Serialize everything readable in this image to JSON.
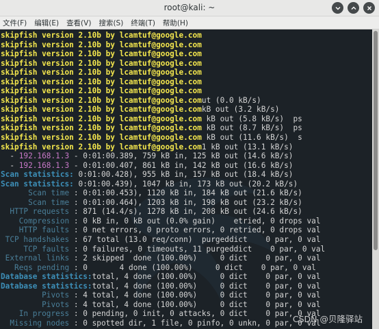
{
  "window": {
    "title": "root@kali: ~",
    "buttons": [
      {
        "name": "minimize",
        "icon": "minimize-icon"
      },
      {
        "name": "maximize",
        "icon": "maximize-icon"
      },
      {
        "name": "close",
        "icon": "close-icon"
      }
    ]
  },
  "menu": [
    {
      "id": "file",
      "label": "文件(F)"
    },
    {
      "id": "edit",
      "label": "编辑(E)"
    },
    {
      "id": "view",
      "label": "查看(V)"
    },
    {
      "id": "search",
      "label": "搜索(S)"
    },
    {
      "id": "terminal",
      "label": "终端(T)"
    },
    {
      "id": "help",
      "label": "帮助(H)"
    }
  ],
  "terminal": {
    "lines": [
      [
        {
          "t": "skipfish version 2.10b by lcamtuf@google.com",
          "c": "yellow"
        }
      ],
      [
        {
          "t": "skipfish version 2.10b by lcamtuf@google.com",
          "c": "yellow"
        }
      ],
      [
        {
          "t": "skipfish version 2.10b by lcamtuf@google.com",
          "c": "yellow"
        }
      ],
      [
        {
          "t": "skipfish version 2.10b by lcamtuf@google.com",
          "c": "yellow"
        }
      ],
      [
        {
          "t": "skipfish version 2.10b by lcamtuf@google.com",
          "c": "yellow"
        }
      ],
      [
        {
          "t": "skipfish version 2.10b by lcamtuf@google.com",
          "c": "yellow"
        }
      ],
      [
        {
          "t": "skipfish version 2.10b by lcamtuf@google.com",
          "c": "yellow"
        }
      ],
      [
        {
          "t": "skipfish version 2.10b by lcamtuf@google.com",
          "c": "yellow"
        },
        {
          "t": "ut (0.0 kB/s)",
          "c": ""
        }
      ],
      [
        {
          "t": "skipfish version 2.10b by lcamtuf@google.com",
          "c": "yellow"
        },
        {
          "t": "kB out (3.2 kB/s)",
          "c": ""
        }
      ],
      [
        {
          "t": "skipfish version 2.10b by lcamtuf@google.com",
          "c": "yellow"
        },
        {
          "t": " kB out (5.8 kB/s)  ps",
          "c": ""
        }
      ],
      [
        {
          "t": "skipfish version 2.10b by lcamtuf@google.com",
          "c": "yellow"
        },
        {
          "t": " kB out (8.7 kB/s)  ps",
          "c": ""
        }
      ],
      [
        {
          "t": "skipfish version 2.10b by lcamtuf@google.com",
          "c": "yellow"
        },
        {
          "t": " kB out (11.6 kB/s)  s",
          "c": ""
        }
      ],
      [
        {
          "t": "skipfish version 2.10b by lcamtuf@google.com",
          "c": "yellow"
        },
        {
          "t": "1 kB out (13.1 kB/s)",
          "c": ""
        }
      ],
      [
        {
          "t": "  - ",
          "c": "dash"
        },
        {
          "t": "192.168.1.3",
          "c": "ip"
        },
        {
          "t": " - 0:01:00.389, 759 kB in, 125 kB out (14.6 kB/s)",
          "c": ""
        }
      ],
      [
        {
          "t": "  - ",
          "c": "dash"
        },
        {
          "t": "192.168.1.3",
          "c": "ip"
        },
        {
          "t": " - 0:01:00.407, 861 kB in, 142 kB out (16.6 kB/s)",
          "c": ""
        }
      ],
      [
        {
          "t": "Scan statistics:",
          "c": "label"
        },
        {
          "t": " 0:01:00.428), 955 kB in, 157 kB out (18.4 kB/s)",
          "c": ""
        }
      ],
      [
        {
          "t": "Scan statistics:",
          "c": "label"
        },
        {
          "t": " 0:01:00.439), 1047 kB in, 173 kB out (20.2 kB/s)",
          "c": ""
        }
      ],
      [
        {
          "t": "      Scan time",
          "c": "dim"
        },
        {
          "t": " : 0:01:00.453), 1120 kB in, 184 kB out (21.6 kB/s)",
          "c": ""
        }
      ],
      [
        {
          "t": "      Scan time",
          "c": "dim"
        },
        {
          "t": " : 0:01:00.464), 1203 kB in, 198 kB out (23.2 kB/s)",
          "c": ""
        }
      ],
      [
        {
          "t": "  HTTP requests",
          "c": "dim"
        },
        {
          "t": " : 871 (14.4/s), 1278 kB in, 208 kB out (24.6 kB/s)",
          "c": ""
        }
      ],
      [
        {
          "t": "    Compression",
          "c": "dim"
        },
        {
          "t": " : 0 kB in, 0 kB out (0.0% gain)    etried, 0 drops val",
          "c": ""
        }
      ],
      [
        {
          "t": "    HTTP faults",
          "c": "dim"
        },
        {
          "t": " : 0 net errors, 0 proto errors, 0 retried, 0 drops val",
          "c": ""
        }
      ],
      [
        {
          "t": " TCP handshakes",
          "c": "dim"
        },
        {
          "t": " : 67 total (13.0 req/conn)  purgeddict    0 par, 0 val",
          "c": ""
        }
      ],
      [
        {
          "t": "     TCP faults",
          "c": "dim"
        },
        {
          "t": " : 0 failures, 0 timeouts, 11 purgeddict    0 par, 0 val",
          "c": ""
        }
      ],
      [
        {
          "t": " External links",
          "c": "dim"
        },
        {
          "t": " : 2 skipped  done (100.00%)     0 dict    0 par, 0 val",
          "c": ""
        }
      ],
      [
        {
          "t": "   Reqs pending",
          "c": "dim"
        },
        {
          "t": " : 0       4 done (100.00%)     0 dict    0 par, 0 val",
          "c": ""
        }
      ],
      [
        {
          "t": "Database statistics:",
          "c": "label"
        },
        {
          "t": "total, 4 done (100.00%)     0 dict    0 par, 0 val",
          "c": ""
        }
      ],
      [
        {
          "t": "Database statistics:",
          "c": "label"
        },
        {
          "t": "total, 4 done (100.00%)     0 dict    0 par, 0 val",
          "c": ""
        }
      ],
      [
        {
          "t": "         Pivots",
          "c": "dim"
        },
        {
          "t": " : 4 total, 4 done (100.00%)     0 dict    0 par, 0 val",
          "c": ""
        }
      ],
      [
        {
          "t": "         Pivots",
          "c": "dim"
        },
        {
          "t": " : 4 total, 4 done (100.00%)     0 dict    0 par, 0 val",
          "c": ""
        }
      ],
      [
        {
          "t": "    In progress",
          "c": "dim"
        },
        {
          "t": " : 0 pending, 0 init, 0 attacks, 0 dict    0 par, 0 val",
          "c": ""
        }
      ],
      [
        {
          "t": "  Missing nodes",
          "c": "dim"
        },
        {
          "t": " : 0 spotted dir, 1 file, 0 pinfo, 0 unkn, 0 par, 0 val",
          "c": ""
        }
      ]
    ]
  },
  "watermark": "CSDN @贝隆驿站",
  "colors": {
    "terminal_bg": "#1c2227",
    "banner": "#f3e64d",
    "label": "#3d8fb8",
    "ip": "#c878c8",
    "text": "#d6d6d6"
  }
}
